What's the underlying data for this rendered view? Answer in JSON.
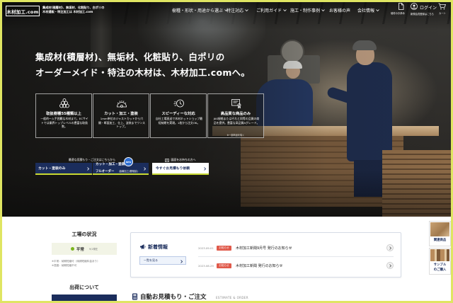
{
  "header": {
    "logo_text": "木材加工.com",
    "tagline_lines": [
      "集成材(積層材)、無垢材、化粧貼り、白ポリの",
      "木材通販・特注加工は 木材加工.com"
    ],
    "nav": [
      {
        "label": "樹種・形状・用途から選ぶ"
      },
      {
        "label": "特注対応"
      },
      {
        "label": "ご利用ガイド"
      },
      {
        "label": "施工・制作事例"
      },
      {
        "label": "お客様の声"
      },
      {
        "label": "会社情報"
      }
    ],
    "utility": {
      "docs_label": "端材のお求め",
      "login_label": "ログイン",
      "register_label": "新規会員登録はこちら",
      "cart_label": "カート"
    }
  },
  "hero": {
    "headline_lines": [
      "集成材(積層材)、無垢材、化粧貼り、白ポリの",
      "オーダーメイド・特注の木材は、木材加工.comへ。"
    ],
    "features": [
      {
        "icon": "wood-stack-icon",
        "title": "取扱樹種55種類以上",
        "desc": "一般的～入手困難な木材まで。ECサイトでは業界トップレベルの豊富な取扱数。"
      },
      {
        "icon": "saw-blade-icon",
        "title": "カット・加工・塗装",
        "desc": "1mm単位のジャストカットから穴開・断面加工、仕上、塗装までワンストップ。"
      },
      {
        "icon": "speed-clock-icon",
        "title": "スピーディーな対応",
        "desc": "自社工場直送で木材ネットショップ最短納期を実現。1枚から注文OK。"
      },
      {
        "icon": "certificate-icon",
        "title": "高品質な商品のみ",
        "desc": "JAS規格またはそれと同等の品質の商品を提供。豊富な高品質Aグレード。",
        "note": "※一部商品を除く"
      }
    ],
    "cta": {
      "order_caption": "最適な見積もり・ご注文はこちらから",
      "cut_only_label": "カット・塗装のみ",
      "full_order_label": "カット・加工・塗装",
      "full_order_sub": "フルオーダー",
      "full_order_note": "曲線加工(要相談)",
      "new_badge": "NEW",
      "drawing_caption": "図面をお持ちの方へ",
      "quote_label": "今すぐお見積もり依頼"
    }
  },
  "factory": {
    "title": "工場の状況",
    "status": "平常",
    "as_of": "9/1現在",
    "notes": [
      "※平常：納期短縮可（納期短縮料金あり）",
      "※混雑：納期短縮不可"
    ]
  },
  "shipping": {
    "title": "出荷について"
  },
  "news": {
    "title": "新着情報",
    "view_all_label": "一覧を見る",
    "items": [
      {
        "date": "2023.09.01",
        "tag": "お知らせ",
        "title": "木材加工新聞9月号 発行のお知らせ"
      },
      {
        "date": "2023.08.29",
        "tag": "お知らせ",
        "title": "木材加工新聞 発行のお知らせ"
      }
    ]
  },
  "estimate": {
    "title": "自動お見積もり・ご注文",
    "subtitle": "ESTIMATE & ORDER"
  },
  "side_links": [
    {
      "label_lines": [
        "関連商品"
      ]
    },
    {
      "label_lines": [
        "サンプル",
        "のご購入"
      ]
    }
  ],
  "colors": {
    "navy": "#1b2d5c",
    "accent_lime": "#c8d932",
    "tag_red": "#e05a4b",
    "status_green": "#7ab51d",
    "frame": "#dfe562"
  }
}
